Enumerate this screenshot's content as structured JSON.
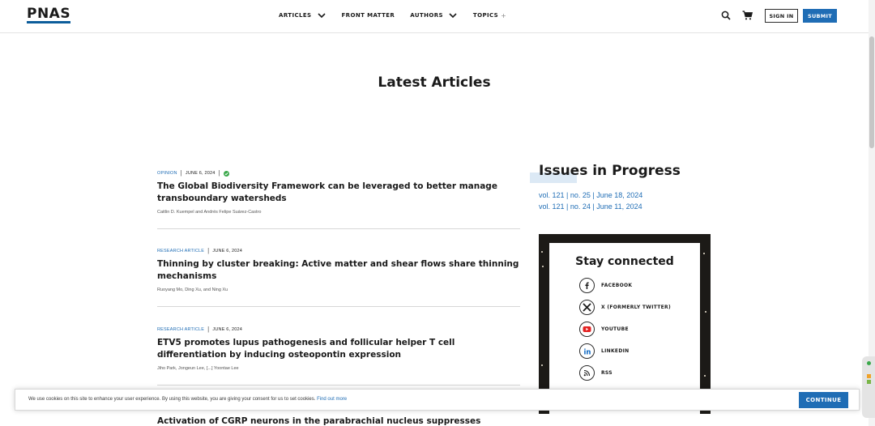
{
  "header": {
    "logo": "PNAS",
    "nav": [
      {
        "label": "ARTICLES",
        "has_chevron": true
      },
      {
        "label": "FRONT MATTER",
        "has_chevron": false
      },
      {
        "label": "AUTHORS",
        "has_chevron": true
      },
      {
        "label": "TOPICS",
        "has_plus": true,
        "suffix": "+"
      }
    ],
    "search_icon": "search-icon",
    "cart_icon": "cart-icon",
    "sign_in_label": "SIGN IN",
    "submit_label": "SUBMIT"
  },
  "colors": {
    "accent": "#1f6db5",
    "logo_underline": "#0c5d9b",
    "check": "#3aa84a"
  },
  "page_title": "Latest Articles",
  "articles": [
    {
      "type": "OPINION",
      "date": "JUNE 6, 2024",
      "has_open_access_icon": true,
      "title": "The Global Biodiversity Framework can be leveraged to better manage transboundary watersheds",
      "authors": "Caitlin D. Kuempel and Andrés Felipe Suárez-Castro"
    },
    {
      "type": "RESEARCH ARTICLE",
      "date": "JUNE 6, 2024",
      "title": "Thinning by cluster breaking: Active matter and shear flows share thinning mechanisms",
      "authors": "Ruoyang Mo, Ding Xu, and Ning Xu"
    },
    {
      "type": "RESEARCH ARTICLE",
      "date": "JUNE 6, 2024",
      "title": "ETV5 promotes lupus pathogenesis and follicular helper T cell differentiation by inducing osteopontin expression",
      "authors": "Jiho Park, Jongeun Lee, [...] Yoontae Lee"
    },
    {
      "title": "Activation of CGRP neurons in the parabrachial nucleus suppresses addictive"
    }
  ],
  "issues": {
    "title": "Issues in Progress",
    "links": [
      "vol. 121 | no. 25 | June 18, 2024",
      "vol. 121 | no. 24 | June 11, 2024"
    ]
  },
  "stay_connected": {
    "title": "Stay connected",
    "items": [
      {
        "label": "FACEBOOK",
        "icon": "facebook-icon"
      },
      {
        "label": "X (FORMERLY TWITTER)",
        "icon": "x-twitter-icon"
      },
      {
        "label": "YOUTUBE",
        "icon": "youtube-icon"
      },
      {
        "label": "LINKEDIN",
        "icon": "linkedin-icon"
      },
      {
        "label": "RSS",
        "icon": "rss-icon"
      }
    ]
  },
  "cookie": {
    "text": "We use cookies on this site to enhance your user experience. By using this website, you are giving your consent for us to set cookies.",
    "link": "Find out more",
    "button": "CONTINUE"
  }
}
